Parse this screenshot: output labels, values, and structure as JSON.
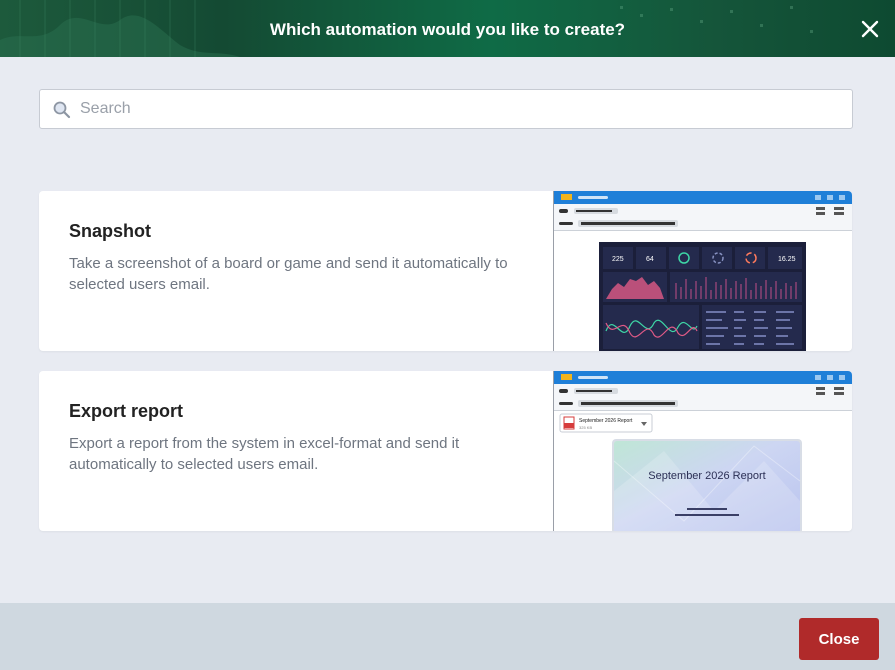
{
  "dialog": {
    "title": "Which automation would you like to create?"
  },
  "search": {
    "placeholder": "Search",
    "value": ""
  },
  "options": [
    {
      "title": "Snapshot",
      "description": "Take a screenshot of a board or game and send it automatically to selected users email.",
      "preview": {
        "stats": [
          "225",
          "64",
          "16.25"
        ]
      }
    },
    {
      "title": "Export report",
      "description": "Export a report from the system in excel-format and send it automatically to selected users email.",
      "preview": {
        "file_name": "September 2026 Report",
        "file_size": "325 KB",
        "report_title": "September 2026 Report"
      }
    }
  ],
  "footer": {
    "close_label": "Close"
  },
  "colors": {
    "header": "#145238",
    "close_button": "#b02a2a",
    "app_bar": "#1f7fd8"
  }
}
